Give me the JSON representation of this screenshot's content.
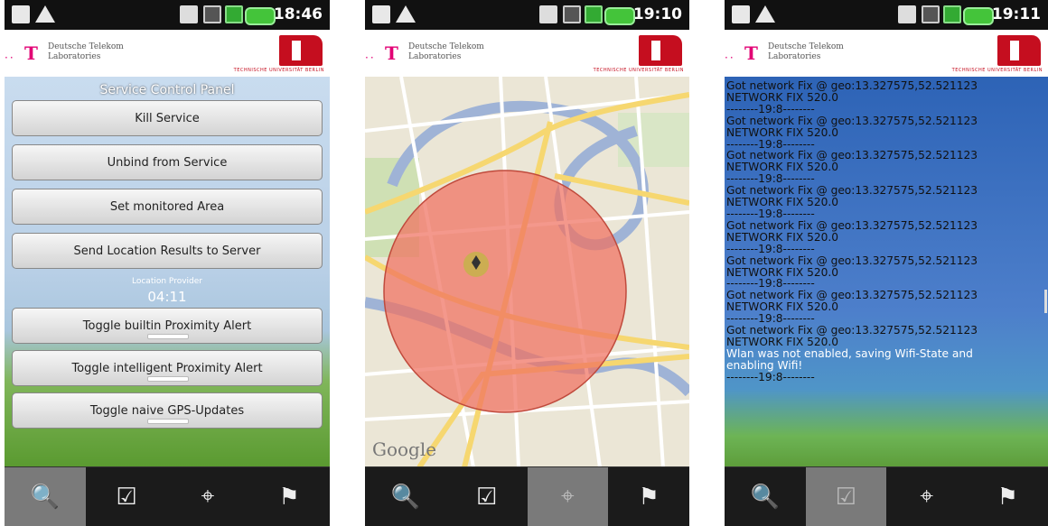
{
  "screens": [
    {
      "time": "18:46"
    },
    {
      "time": "19:10"
    },
    {
      "time": "19:11"
    }
  ],
  "header": {
    "telekom_name": "Deutsche Telekom\nLaboratories",
    "tu_subtitle": "TECHNISCHE UNIVERSITÄT BERLIN"
  },
  "panel1": {
    "title": "Service Control Panel",
    "buttons": [
      {
        "label": "Kill Service"
      },
      {
        "label": "Unbind from Service"
      },
      {
        "label": "Set monitored Area"
      },
      {
        "label": "Send Location Results to Server"
      },
      {
        "label": "Toggle builtin Proximity Alert"
      },
      {
        "label": "Toggle intelligent Proximity Alert"
      },
      {
        "label": "Toggle naive GPS-Updates"
      }
    ],
    "location_provider_label": "Location Provider",
    "location_provider_time": "04:11"
  },
  "panel2": {
    "map_attribution": "Google"
  },
  "panel3": {
    "log_lines": [
      "Got network Fix @ geo:13.327575,52.521123",
      "NETWORK FIX 520.0",
      "--------19:8--------",
      "Got network Fix @ geo:13.327575,52.521123",
      "NETWORK FIX 520.0",
      "--------19:8--------",
      "Got network Fix @ geo:13.327575,52.521123",
      "NETWORK FIX 520.0",
      "--------19:8--------",
      "Got network Fix @ geo:13.327575,52.521123",
      "NETWORK FIX 520.0",
      "--------19:8--------",
      "Got network Fix @ geo:13.327575,52.521123",
      "NETWORK FIX 520.0",
      "--------19:8--------",
      "Got network Fix @ geo:13.327575,52.521123",
      "NETWORK FIX 520.0",
      "--------19:8--------",
      "Got network Fix @ geo:13.327575,52.521123",
      "NETWORK FIX 520.0",
      "--------19:8--------",
      "Got network Fix @ geo:13.327575,52.521123",
      "NETWORK FIX 520.0"
    ],
    "warning": "Wlan was not enabled, saving Wifi-State and\nenabling Wifi!",
    "last_line": "--------19:8--------"
  },
  "tabs": [
    {
      "icon": "search-tool-icon"
    },
    {
      "icon": "checklist-icon"
    },
    {
      "icon": "crosshair-icon"
    },
    {
      "icon": "person-flag-icon"
    }
  ],
  "selected_tab": [
    0,
    2,
    1
  ]
}
